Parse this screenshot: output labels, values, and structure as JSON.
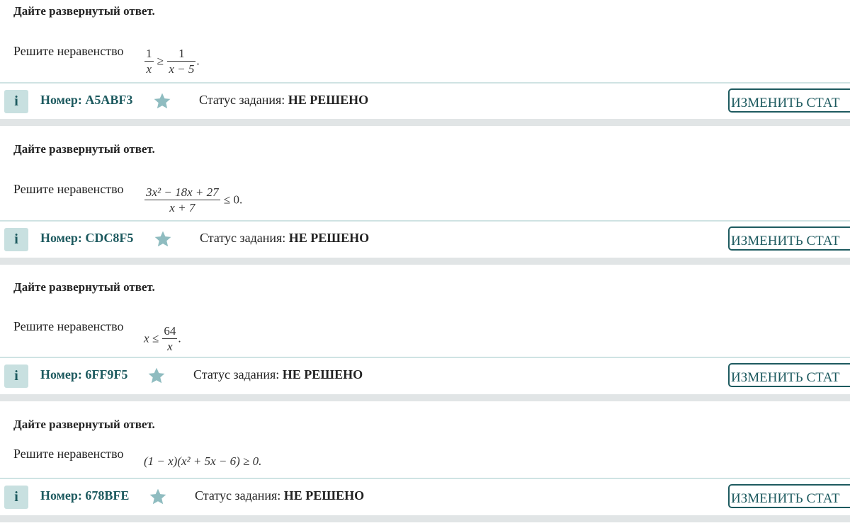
{
  "common": {
    "instruction": "Дайте развернутый ответ.",
    "solve_label": "Решите неравенство",
    "number_prefix": "Номер: ",
    "status_prefix": "Статус задания: ",
    "status_value": "НЕ РЕШЕНО",
    "change_button": "ИЗМЕНИТЬ СТАТ",
    "info_label": "i"
  },
  "tasks": [
    {
      "id": "A5ABF3",
      "math": {
        "num1": "1",
        "den1": "x",
        "rel": "≥",
        "num2": "1",
        "den2": "x − 5",
        "tail": "."
      }
    },
    {
      "id": "CDC8F5",
      "math": {
        "num": "3x² − 18x + 27",
        "den": "x + 7",
        "tail": "≤ 0."
      }
    },
    {
      "id": "6FF9F5",
      "math": {
        "lhs": "x ≤",
        "num": "64",
        "den": "x",
        "tail": "."
      }
    },
    {
      "id": "678BFE",
      "math": {
        "expr": "(1 − x)(x² + 5x − 6) ≥ 0."
      }
    }
  ],
  "colors": {
    "accent": "#1d5a5f",
    "info_bg": "#c8e0e0",
    "star": "#8fbcc0",
    "separator": "#e1e5e6"
  }
}
